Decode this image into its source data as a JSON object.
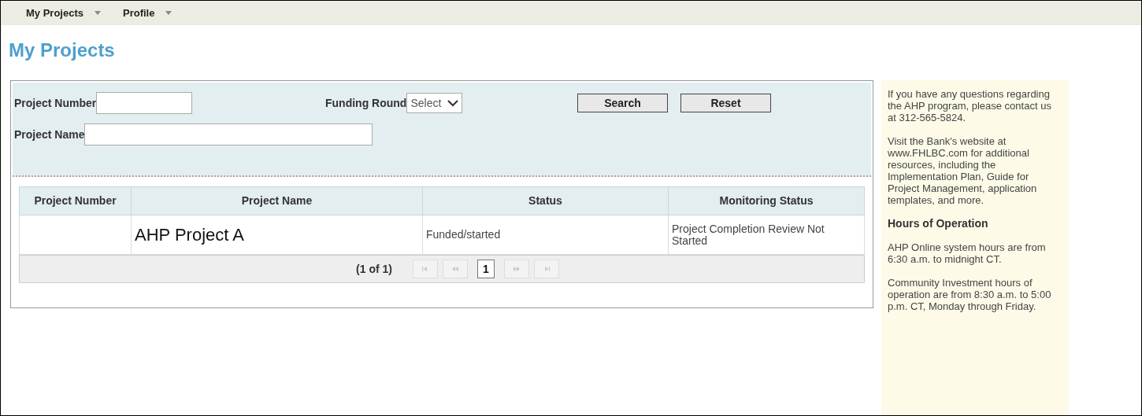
{
  "menu": [
    {
      "label": "My Projects"
    },
    {
      "label": "Profile"
    }
  ],
  "title": "My Projects",
  "search": {
    "fields": [
      {
        "label": "Project Number",
        "kind": "input"
      },
      {
        "label": "Funding Round",
        "kind": "select",
        "value": "Select"
      },
      {
        "label": "Project Name",
        "kind": "input"
      }
    ],
    "buttons": [
      "Search",
      "Reset"
    ]
  },
  "table": {
    "columns": [
      "Project Number",
      "Project Name",
      "Status",
      "Monitoring Status"
    ],
    "rows": [
      [
        "",
        "AHP Project A",
        "Funded/started",
        "Project Completion Review Not Started"
      ]
    ]
  },
  "pager": {
    "summary": "(1 of 1)",
    "controls": [
      {
        "kind": "first",
        "disabled": true
      },
      {
        "kind": "prev",
        "disabled": true
      },
      {
        "kind": "page",
        "label": "1",
        "selected": true
      },
      {
        "kind": "next",
        "disabled": true
      },
      {
        "kind": "last",
        "disabled": true
      }
    ]
  },
  "sidebar": [
    {
      "kind": "text",
      "text": "If you have any questions regarding the AHP program, please contact us at 312-565-5824."
    },
    {
      "kind": "text",
      "text": "Visit the Bank's website at www.FHLBC.com for additional resources, including the Implementation Plan, Guide for Project Management, application templates, and more."
    },
    {
      "kind": "heading",
      "text": "Hours of Operation"
    },
    {
      "kind": "text",
      "text": "AHP Online system hours are from 6:30 a.m. to midnight CT."
    },
    {
      "kind": "text",
      "text": "Community Investment hours of operation are from 8:30 a.m. to 5:00 p.m. CT, Monday through Friday."
    }
  ]
}
